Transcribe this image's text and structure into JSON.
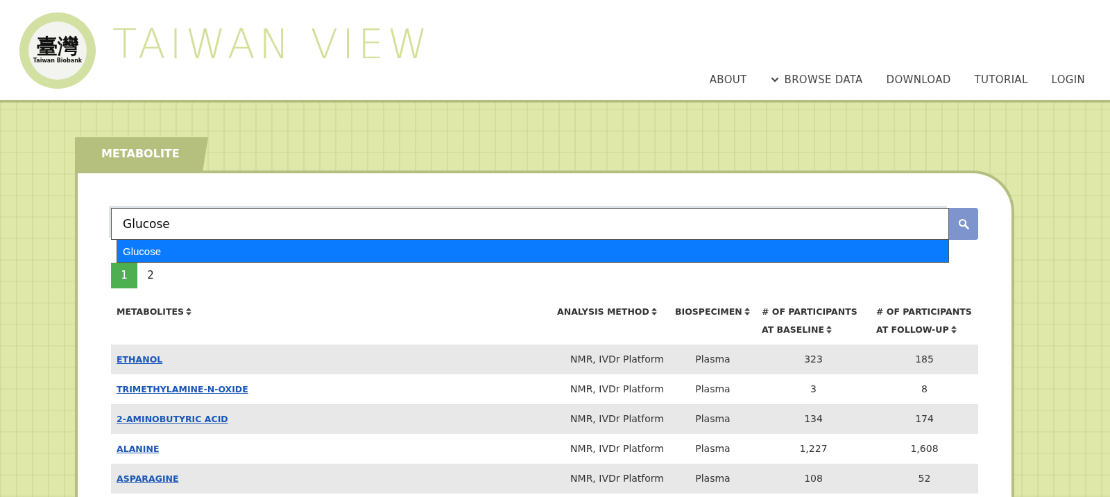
{
  "logo": {
    "characters": "臺灣",
    "caption": "Taiwan Biobank",
    "title": "TAIWAN VIEW"
  },
  "nav": [
    {
      "label": "ABOUT",
      "kind": "link"
    },
    {
      "label": "BROWSE DATA",
      "kind": "dropdown"
    },
    {
      "label": "DOWNLOAD",
      "kind": "link"
    },
    {
      "label": "TUTORIAL",
      "kind": "link"
    },
    {
      "label": "LOGIN",
      "kind": "link"
    }
  ],
  "section_tab": "METABOLITE",
  "search": {
    "value": "Glucose"
  },
  "suggestions": [
    {
      "label": "Glucose",
      "selected": true
    }
  ],
  "pagination": [
    {
      "label": "1",
      "selected": true
    },
    {
      "label": "2",
      "selected": false
    }
  ],
  "table": {
    "columns": [
      "METABOLITES",
      "ANALYSIS METHOD",
      "BIOSPECIMEN",
      "# OF PARTICIPANTS AT BASELINE",
      "# OF PARTICIPANTS AT FOLLOW-UP"
    ],
    "rows": [
      [
        "ETHANOL",
        "NMR, IVDr Platform",
        "Plasma",
        "323",
        "185"
      ],
      [
        "TRIMETHYLAMINE-N-OXIDE",
        "NMR, IVDr Platform",
        "Plasma",
        "3",
        "8"
      ],
      [
        "2-AMINOBUTYRIC ACID",
        "NMR, IVDr Platform",
        "Plasma",
        "134",
        "174"
      ],
      [
        "ALANINE",
        "NMR, IVDr Platform",
        "Plasma",
        "1,227",
        "1,608"
      ],
      [
        "ASPARAGINE",
        "NMR, IVDr Platform",
        "Plasma",
        "108",
        "52"
      ]
    ]
  }
}
